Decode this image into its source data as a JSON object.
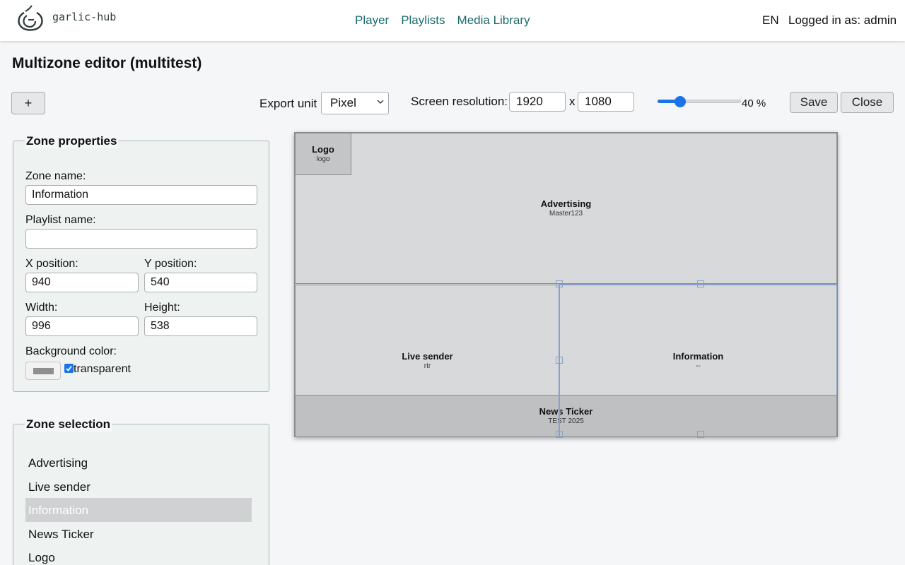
{
  "header": {
    "logo_text": "garlic-hub",
    "nav": [
      "Player",
      "Playlists",
      "Media Library"
    ],
    "lang": "EN",
    "logged_in": "Logged in as: admin"
  },
  "page": {
    "title": "Multizone editor (multitest)"
  },
  "toolbar": {
    "add_label": "+",
    "export_unit_label": "Export unit",
    "export_unit_value": "Pixel",
    "screen_res_label": "Screen resolution:",
    "res_width": "1920",
    "res_x": "x",
    "res_height": "1080",
    "zoom_value": 40,
    "zoom_text": "40 %",
    "save_label": "Save",
    "close_label": "Close"
  },
  "zone_properties": {
    "legend": "Zone properties",
    "zone_name_label": "Zone name:",
    "zone_name_value": "Information",
    "playlist_name_label": "Playlist name:",
    "playlist_name_value": "",
    "x_label": "X position:",
    "x_value": "940",
    "y_label": "Y position:",
    "y_value": "540",
    "width_label": "Width:",
    "width_value": "996",
    "height_label": "Height:",
    "height_value": "538",
    "bg_label": "Background color:",
    "transparent_label": "transparent",
    "transparent_checked": true
  },
  "zone_selection": {
    "legend": "Zone selection",
    "items": [
      "Advertising",
      "Live sender",
      "Information",
      "News Ticker",
      "Logo"
    ],
    "selected": "Information"
  },
  "canvas": {
    "zones": [
      {
        "name": "Advertising",
        "playlist": "Master123"
      },
      {
        "name": "Live sender",
        "playlist": "rtr"
      },
      {
        "name": "Information",
        "playlist": "--"
      },
      {
        "name": "News Ticker",
        "playlist": "TEST 2025"
      },
      {
        "name": "Logo",
        "playlist": "logo"
      }
    ]
  },
  "colors": {
    "accent": "#1a73e8",
    "nav_link": "#1a6b6b",
    "zone_bg": "#d8d9da",
    "ticker_bg": "#bfc0c2",
    "logo_bg": "#c4c5c7"
  }
}
